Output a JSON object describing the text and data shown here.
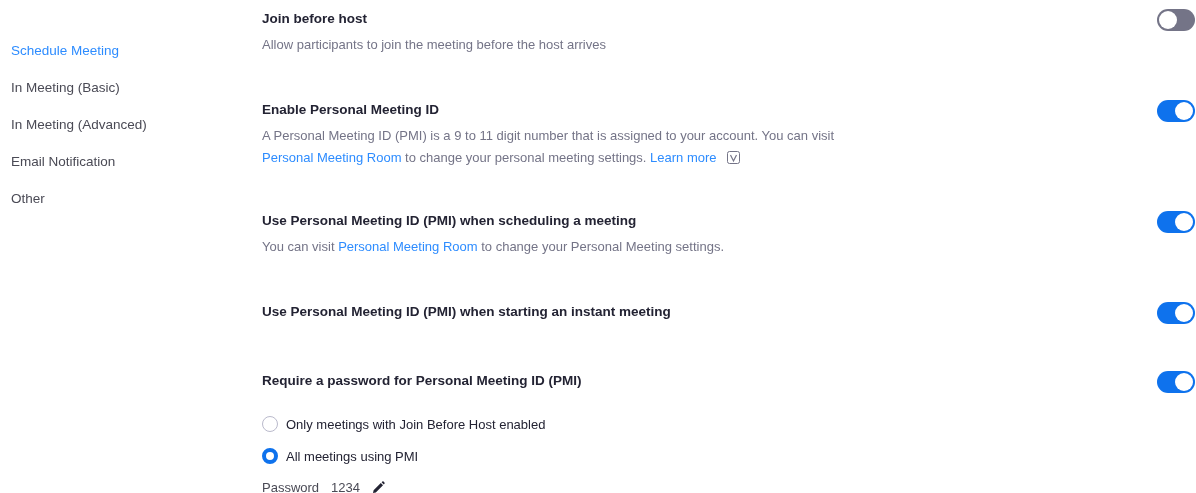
{
  "sidebar": {
    "items": [
      {
        "label": "Schedule Meeting",
        "selected": true
      },
      {
        "label": "In Meeting (Basic)",
        "selected": false
      },
      {
        "label": "In Meeting (Advanced)",
        "selected": false
      },
      {
        "label": "Email Notification",
        "selected": false
      },
      {
        "label": "Other",
        "selected": false
      }
    ]
  },
  "settings": [
    {
      "title": "Join before host",
      "on": false,
      "description": [
        {
          "kind": "text",
          "text": "Allow participants to join the meeting before the host arrives"
        }
      ]
    },
    {
      "title": "Enable Personal Meeting ID",
      "on": true,
      "info_icon": true,
      "description": [
        {
          "kind": "text",
          "text": "A Personal Meeting ID (PMI) is a 9 to 11 digit number that is assigned to your account. You can visit "
        },
        {
          "kind": "link",
          "text": "Personal Meeting Room"
        },
        {
          "kind": "text",
          "text": " to change your personal meeting settings. "
        },
        {
          "kind": "link",
          "text": "Learn more"
        }
      ]
    },
    {
      "title": "Use Personal Meeting ID (PMI) when scheduling a meeting",
      "on": true,
      "description": [
        {
          "kind": "text",
          "text": "You can visit "
        },
        {
          "kind": "link",
          "text": "Personal Meeting Room"
        },
        {
          "kind": "text",
          "text": " to change your Personal Meeting settings."
        }
      ]
    },
    {
      "title": "Use Personal Meeting ID (PMI) when starting an instant meeting",
      "on": true
    },
    {
      "title": "Require a password for Personal Meeting ID (PMI)",
      "on": true,
      "options": [
        {
          "label": "Only meetings with Join Before Host enabled",
          "selected": false
        },
        {
          "label": "All meetings using PMI",
          "selected": true
        }
      ],
      "password": {
        "label": "Password",
        "value": "1234"
      }
    }
  ]
}
